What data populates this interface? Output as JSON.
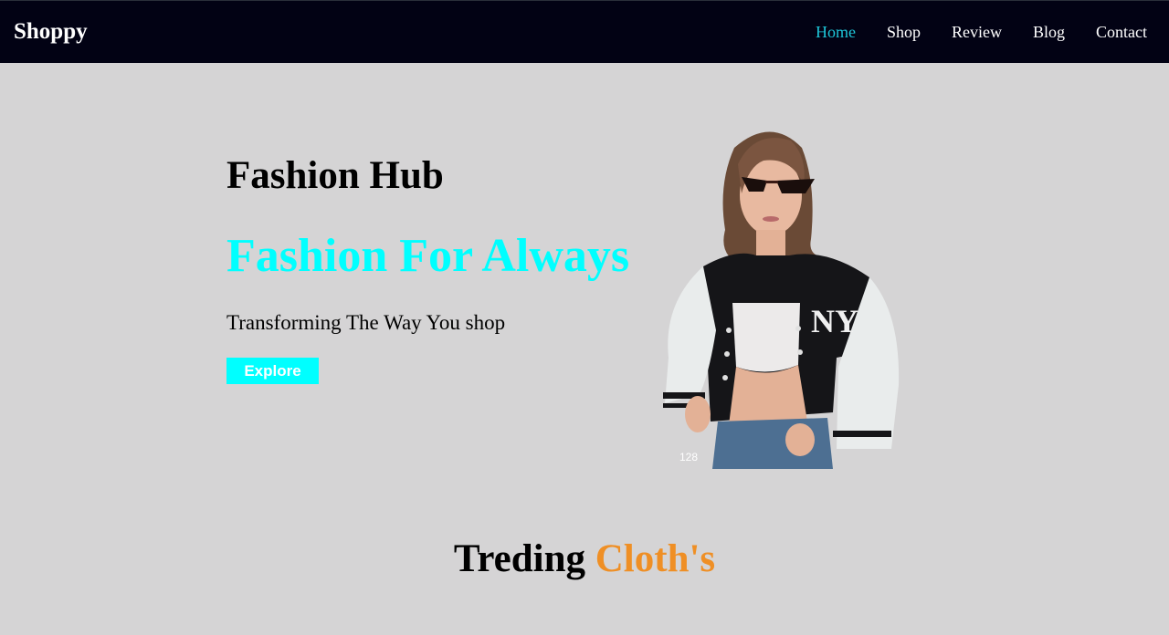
{
  "brand": "Shoppy",
  "nav": {
    "items": [
      {
        "label": "Home",
        "active": true
      },
      {
        "label": "Shop",
        "active": false
      },
      {
        "label": "Review",
        "active": false
      },
      {
        "label": "Blog",
        "active": false
      },
      {
        "label": "Contact",
        "active": false
      }
    ]
  },
  "hero": {
    "title": "Fashion Hub",
    "tagline": "Fashion For Always",
    "subtitle": "Transforming The Way You shop",
    "button_label": "Explore",
    "image_caption": "128"
  },
  "section": {
    "title_part1": "Treding",
    "title_part2": "Cloth's"
  },
  "colors": {
    "navbar_bg": "#020214",
    "page_bg": "#d5d4d5",
    "accent_cyan": "#00ffff",
    "active_nav": "#1ec6d8",
    "accent_orange": "#ef8f25"
  }
}
